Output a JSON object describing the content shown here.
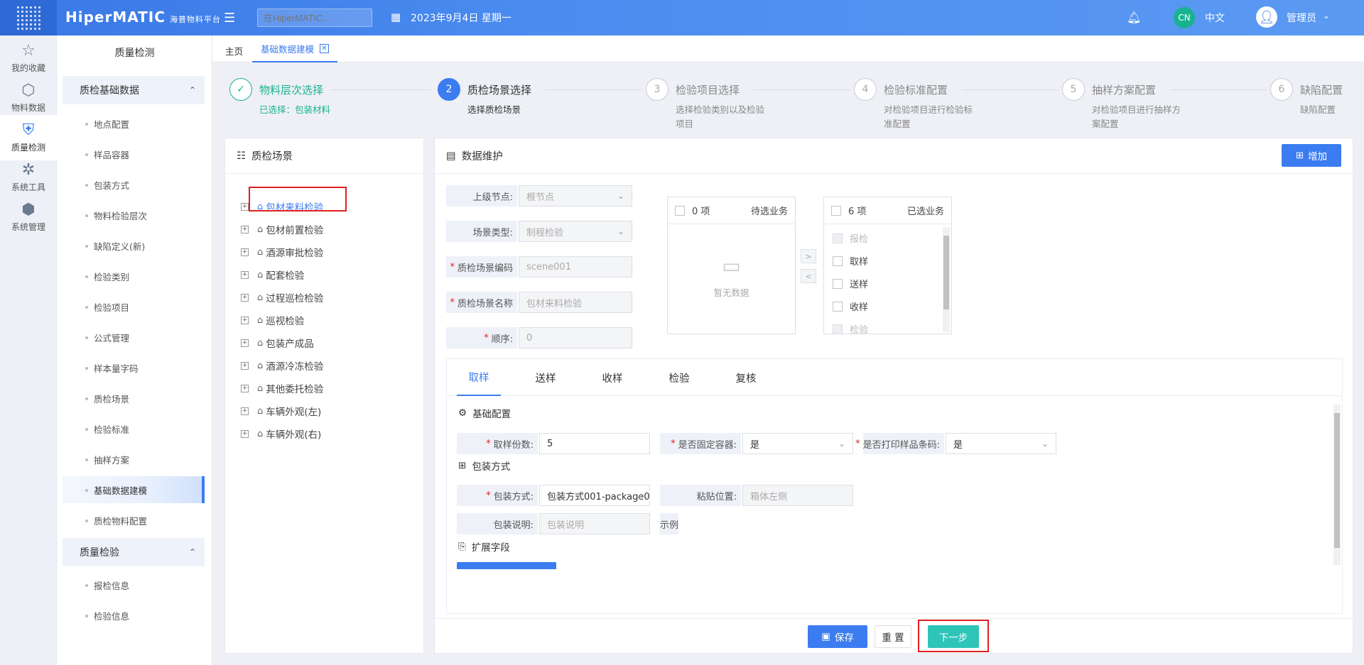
{
  "header": {
    "brand": "HiperMATIC",
    "brand_sub": "海普物料平台",
    "search_placeholder": "在HiperMATIC...",
    "date": "2023年9月4日 星期一",
    "lang_badge": "CN",
    "lang": "中文",
    "user": "管理员"
  },
  "rail": [
    {
      "label": "我的收藏",
      "icon": "star-icon"
    },
    {
      "label": "物料数据",
      "icon": "cube-icon"
    },
    {
      "label": "质量检测",
      "icon": "shield-check-icon"
    },
    {
      "label": "系统工具",
      "icon": "network-icon"
    },
    {
      "label": "系统管理",
      "icon": "hexagon-icon"
    }
  ],
  "sidebar": {
    "title": "质量检测",
    "group1": "质检基础数据",
    "group1_items": [
      "地点配置",
      "样品容器",
      "包装方式",
      "物料检验层次",
      "缺陷定义(新)",
      "检验类别",
      "检验项目",
      "公式管理",
      "样本量字码",
      "质检场景",
      "检验标准",
      "抽样方案",
      "基础数据建模",
      "质检物料配置"
    ],
    "group2": "质量检验",
    "group2_items": [
      "报检信息",
      "检验信息"
    ]
  },
  "tabs": {
    "home": "主页",
    "active": "基础数据建模"
  },
  "steps": [
    {
      "num": "✓",
      "title": "物料层次选择",
      "desc": "已选择：包装材料"
    },
    {
      "num": "2",
      "title": "质检场景选择",
      "desc": "选择质检场景"
    },
    {
      "num": "3",
      "title": "检验项目选择",
      "desc": "选择检验类别以及检验项目"
    },
    {
      "num": "4",
      "title": "检验标准配置",
      "desc": "对检验项目进行检验标准配置"
    },
    {
      "num": "5",
      "title": "抽样方案配置",
      "desc": "对检验项目进行抽样方案配置"
    },
    {
      "num": "6",
      "title": "缺陷配置",
      "desc": "缺陷配置"
    }
  ],
  "tree": {
    "title": "质检场景",
    "items": [
      "包材来料检验",
      "包材前置检验",
      "酒源审批检验",
      "配套检验",
      "过程巡检检验",
      "巡视检验",
      "包装产成品",
      "酒源冷冻检验",
      "其他委托检验",
      "车辆外观(左)",
      "车辆外观(右)"
    ]
  },
  "form": {
    "title": "数据维护",
    "add_label": "增加",
    "parent_label": "上级节点:",
    "parent_value": "根节点",
    "type_label": "场景类型:",
    "type_value": "制程检验",
    "code_label": "质检场景编码",
    "code_value": "scene001",
    "name_label": "质检场景名称",
    "name_value": "包材来料检验",
    "order_label": "顺序:",
    "order_value": "0"
  },
  "transfer": {
    "left_count": "0 项",
    "left_title": "待选业务",
    "empty_text": "暂无数据",
    "right_count": "6 项",
    "right_title": "已选业务",
    "right_items": [
      "报检",
      "取样",
      "送样",
      "收样",
      "检验"
    ]
  },
  "subtabs": [
    "取样",
    "送样",
    "收样",
    "检验",
    "复核"
  ],
  "sampling": {
    "basic_section": "基础配置",
    "copies_label": "取样份数:",
    "copies_value": "5",
    "fixed_container_label": "是否固定容器:",
    "fixed_container_value": "是",
    "print_barcode_label": "是否打印样品条码:",
    "print_barcode_value": "是",
    "pack_section": "包装方式",
    "pack_label": "包装方式:",
    "pack_value": "包装方式001-package0...",
    "paste_label": "粘贴位置:",
    "paste_placeholder": "箱体左侧",
    "pack_desc_label": "包装说明:",
    "pack_desc_placeholder": "包装说明",
    "example_label": "示例",
    "ext_section": "扩展字段"
  },
  "footer": {
    "save": "保存",
    "reset": "重 置",
    "next": "下一步"
  },
  "colors": {
    "primary": "#3b7cf0",
    "success": "#19b28f",
    "highlight": "#e02020",
    "next_btn": "#2fc4b8"
  }
}
